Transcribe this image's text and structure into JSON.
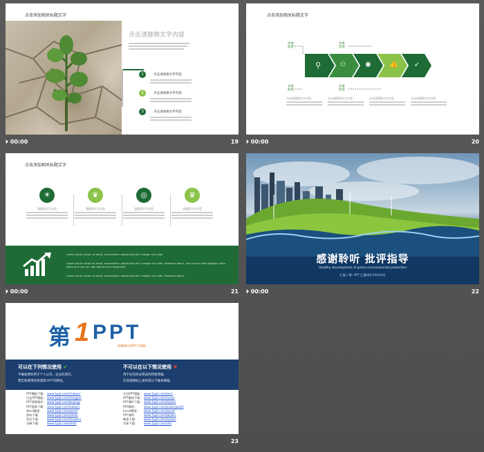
{
  "slides": [
    {
      "num": "19",
      "time": "00:00",
      "title": "点击添加相关标题文字",
      "heading": "点击请替换文字内容",
      "bullets": [
        "点击请替换文字内容",
        "点击请替换文字内容",
        "点击请替换文字内容"
      ],
      "markers": [
        "1",
        "2",
        "3"
      ]
    },
    {
      "num": "20",
      "time": "00:00",
      "title": "点击添加相关标题文字",
      "tops": [
        "文本\n标签",
        "文本\n标签"
      ],
      "bottoms": [
        "文本\n标签",
        "文本\n标签"
      ],
      "captions": [
        "点击请替换文字内容",
        "点击请替换文字内容",
        "点击请替换文字内容",
        "点击请替换文字内容"
      ]
    },
    {
      "num": "21",
      "time": "00:00",
      "title": "点击添加相关标题文字",
      "items": [
        "请替换文字内容",
        "请替换文字内容",
        "请替换文字内容",
        "请替换文字内容"
      ],
      "lines": [
        "Lorem ipsum dolor sit amet, consectetur adipisicing elit. Integer nec odio.",
        "Lorem ipsum dolor sit amet, consectetur adipisicing elit. Integer nec odio. Praesent libero. Sed cursus ante dapibus diam. Nulla quis sem at nibh elementum imperdiet.",
        "Lorem ipsum dolor sit amet, consectetur adipisicing elit. Integer nec odio. Praesent libero."
      ]
    },
    {
      "num": "22",
      "time": "00:00",
      "main": "感谢聆听 批评指导",
      "sub": "Healthy development of green environmental protection",
      "sub2": "汇报人:第一PPT  汇报时间:XX年XX月"
    },
    {
      "num": "23",
      "logo_a": "第",
      "logo_b": "1",
      "logo_c": "PPT",
      "logo_url": "WWW.1PPT.COM",
      "can_title": "可以在下列情况使用",
      "can": [
        "不做收费的用于个人公司，企业的演示。",
        "需告知使用的来源第1PPT的网址。"
      ],
      "cannot_title": "不可以在以下情况使用",
      "cannot": [
        "用于任何商业用途的转售转载。",
        "在其他网站上发布或以下载本模版。"
      ],
      "links_left": [
        [
          "PPT模板下载：",
          "www.1ppt.com/moban/"
        ],
        [
          "行业PPT模板：",
          "www.1ppt.com/hangye/"
        ],
        [
          "PPT背景图片：",
          "www.1ppt.com/beijing/"
        ],
        [
          "PPT图表下载：",
          "www.1ppt.com/tubiao/"
        ],
        [
          "Word教程：",
          "www.1ppt.com/word/"
        ],
        [
          "资料下载：",
          "www.1ppt.com/ziliao/"
        ],
        [
          "范文下载：",
          "www.1ppt.com/fanwen/"
        ],
        [
          "试卷下载：",
          "www.1ppt.com/shiti/"
        ]
      ],
      "links_right": [
        [
          "节日PPT模板：",
          "www.1ppt.com/jieri/"
        ],
        [
          "PPT素材下载：",
          "www.1ppt.com/sucai/"
        ],
        [
          "PPT课件下载：",
          "www.1ppt.com/kejian/"
        ],
        [
          "PPT教程：",
          "www.1ppt.com/powerpoint/"
        ],
        [
          "Excel教程：",
          "www.1ppt.com/excel/"
        ],
        [
          "PPT课件：",
          "www.1ppt.com/kejian/"
        ],
        [
          "教案下载：",
          "www.1ppt.com/jiaoan/"
        ],
        [
          "字体下载：",
          "www.1ppt.com/ziti/"
        ]
      ]
    }
  ],
  "colors": {
    "green_dark": "#1e6b35",
    "green_mid": "#3a8c3f",
    "green_light": "#8bc34a",
    "navy": "#1c3e6e",
    "orange": "#e8731a",
    "blue": "#1e62a8"
  },
  "icons": [
    "search-icon",
    "people-icon",
    "eye-icon",
    "thumbs-up-icon",
    "rocket-icon",
    "lightbulb-icon",
    "leaf-icon",
    "target-icon",
    "trophy-icon",
    "chart-arrow-icon",
    "check-icon",
    "cross-icon",
    "play-icon"
  ]
}
